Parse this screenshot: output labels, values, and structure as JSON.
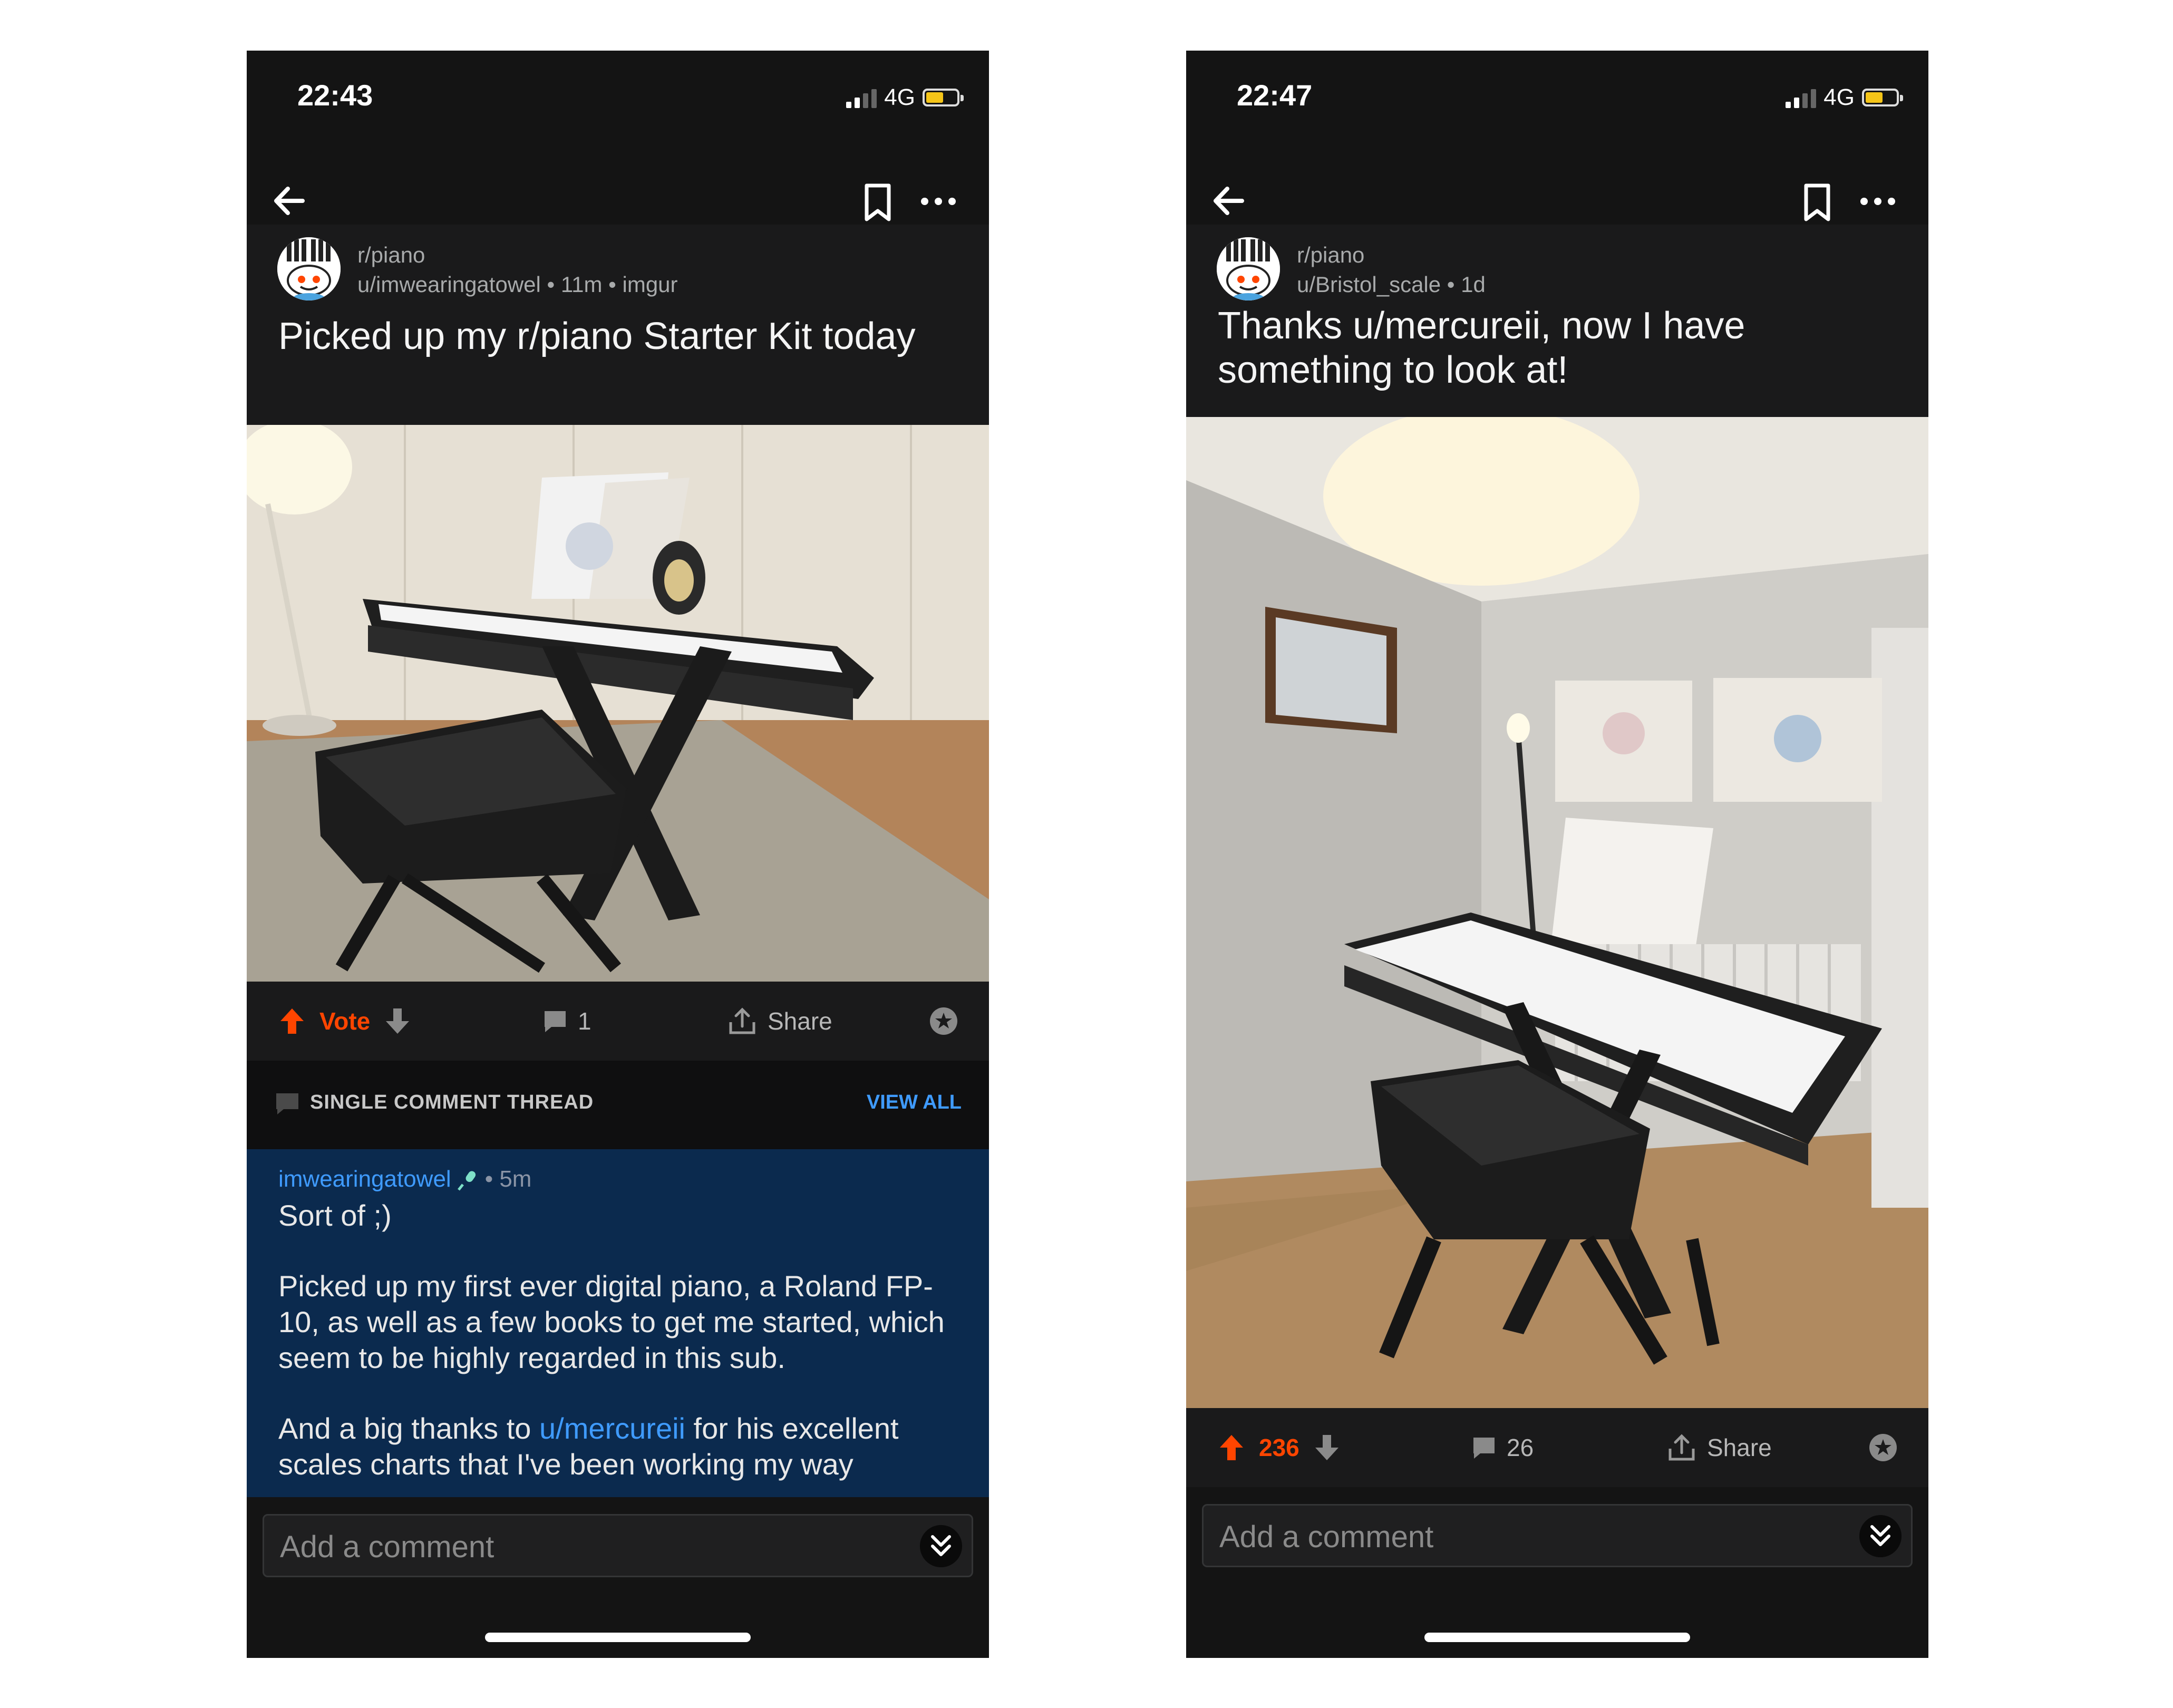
{
  "left": {
    "status": {
      "time": "22:43",
      "network": "4G"
    },
    "post": {
      "subreddit": "r/piano",
      "byline": "u/imwearingatowel • 11m • imgur",
      "title": "Picked up my r/piano Starter Kit today"
    },
    "actions": {
      "vote_label": "Vote",
      "comment_count": "1",
      "share_label": "Share"
    },
    "thread": {
      "label": "SINGLE COMMENT THREAD",
      "view_all": "VIEW ALL"
    },
    "comment": {
      "author": "imwearingatowel",
      "age": "• 5m",
      "line1": "Sort of ;)",
      "para1": "Picked up my first ever digital piano, a Roland FP-10, as well as a few books to get me started, which seem to be highly regarded in this sub.",
      "para2_pre": "And a big thanks to ",
      "para2_link": "u/mercureii",
      "para2_post": " for his excellent scales charts that I've been working my way"
    },
    "composer": {
      "placeholder": "Add a comment"
    }
  },
  "right": {
    "status": {
      "time": "22:47",
      "network": "4G"
    },
    "post": {
      "subreddit": "r/piano",
      "byline": "u/Bristol_scale • 1d",
      "title": "Thanks u/mercureii, now I have something to look at!"
    },
    "actions": {
      "score": "236",
      "comment_count": "26",
      "share_label": "Share"
    },
    "composer": {
      "placeholder": "Add a comment"
    }
  },
  "colors": {
    "upvote": "#ff4500",
    "link": "#3f9bff",
    "comment_bg": "#0b2a4e",
    "battery": "#f5c518"
  },
  "icons": [
    "back-arrow-icon",
    "bookmark-icon",
    "more-icon",
    "upvote-icon",
    "downvote-icon",
    "comment-icon",
    "share-icon",
    "award-icon",
    "expand-icon",
    "microphone-icon",
    "signal-icon",
    "battery-icon"
  ]
}
